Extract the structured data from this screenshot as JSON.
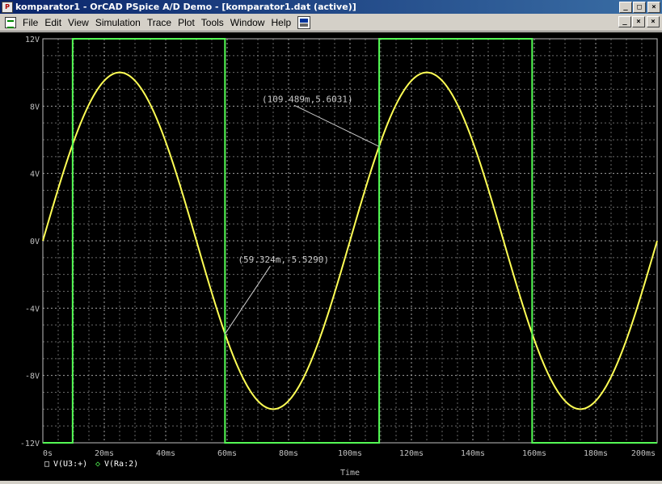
{
  "window": {
    "title": "komparator1 - OrCAD PSpice A/D Demo  - [komparator1.dat (active)]",
    "controls": [
      "_",
      "□",
      "×"
    ]
  },
  "menu": {
    "items": [
      {
        "label": "File"
      },
      {
        "label": "Edit"
      },
      {
        "label": "View"
      },
      {
        "label": "Simulation"
      },
      {
        "label": "Trace"
      },
      {
        "label": "Plot"
      },
      {
        "label": "Tools"
      },
      {
        "label": "Window"
      },
      {
        "label": "Help"
      }
    ],
    "mdi_controls": [
      "_",
      "×",
      "×"
    ]
  },
  "colors": {
    "background": "#000000",
    "grid": "#bfbfbf",
    "sine": "#ffff55",
    "square": "#55ff55",
    "text": "#c0c0c0"
  },
  "chart_data": {
    "type": "line",
    "xlabel": "Time",
    "xlim": [
      0,
      200
    ],
    "ylim": [
      -12,
      12
    ],
    "x_ticks": [
      "0s",
      "20ms",
      "40ms",
      "60ms",
      "80ms",
      "100ms",
      "120ms",
      "140ms",
      "160ms",
      "180ms",
      "200ms"
    ],
    "y_ticks": [
      "12V",
      "8V",
      "4V",
      "0V",
      "-4V",
      "-8V",
      "-12V"
    ],
    "y_tick_values": [
      12,
      8,
      4,
      0,
      -4,
      -8,
      -12
    ],
    "grid": true,
    "legend_placement": "bottom-left",
    "series": [
      {
        "name": "V(U3:+)",
        "marker": "□",
        "color": "#ffff55",
        "shape": "sine",
        "amplitude": 10,
        "period_ms": 100,
        "x": [
          0,
          12.5,
          25,
          37.5,
          50,
          62.5,
          75,
          87.5,
          100,
          112.5,
          125,
          137.5,
          150,
          162.5,
          175,
          187.5,
          200
        ],
        "y": [
          0,
          7.07,
          10,
          7.07,
          0,
          -7.07,
          -10,
          -7.07,
          0,
          7.07,
          10,
          7.07,
          0,
          -7.07,
          -10,
          -7.07,
          0
        ]
      },
      {
        "name": "V(Ra:2)",
        "marker": "◇",
        "color": "#55ff55",
        "shape": "square",
        "x": [
          0,
          9.7,
          9.7,
          59.3,
          59.3,
          109.5,
          109.5,
          159.3,
          159.3,
          200
        ],
        "y": [
          -12,
          -12,
          12,
          12,
          -12,
          -12,
          12,
          12,
          -12,
          -12
        ]
      }
    ],
    "annotations": [
      {
        "text": "(109.489m,5.6031)",
        "x": 109.489,
        "y": 5.6031
      },
      {
        "text": "(59.324m,-5.5290)",
        "x": 59.324,
        "y": -5.529
      }
    ]
  }
}
